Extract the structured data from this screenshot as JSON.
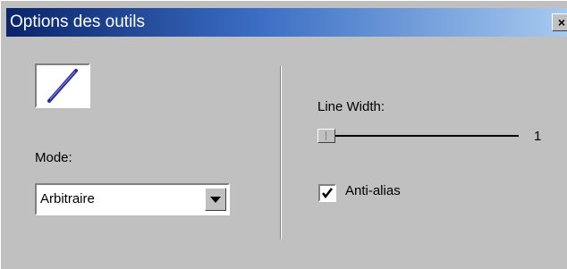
{
  "window": {
    "title": "Options des outils",
    "close_glyph": "×",
    "close_icon": "close-icon"
  },
  "tool": {
    "icon": "line-tool-icon",
    "stroke_color": "#2a2aa0"
  },
  "mode": {
    "label": "Mode:",
    "value": "Arbitraire",
    "dropdown_icon": "chevron-down-icon"
  },
  "line_width": {
    "label": "Line Width:",
    "value": "1",
    "min": 1,
    "max": 100
  },
  "anti_alias": {
    "label": "Anti-alias",
    "checked": true
  },
  "colors": {
    "face": "#c0c0c0",
    "titlebar_start": "#0a246a",
    "titlebar_end": "#a6caf0"
  }
}
